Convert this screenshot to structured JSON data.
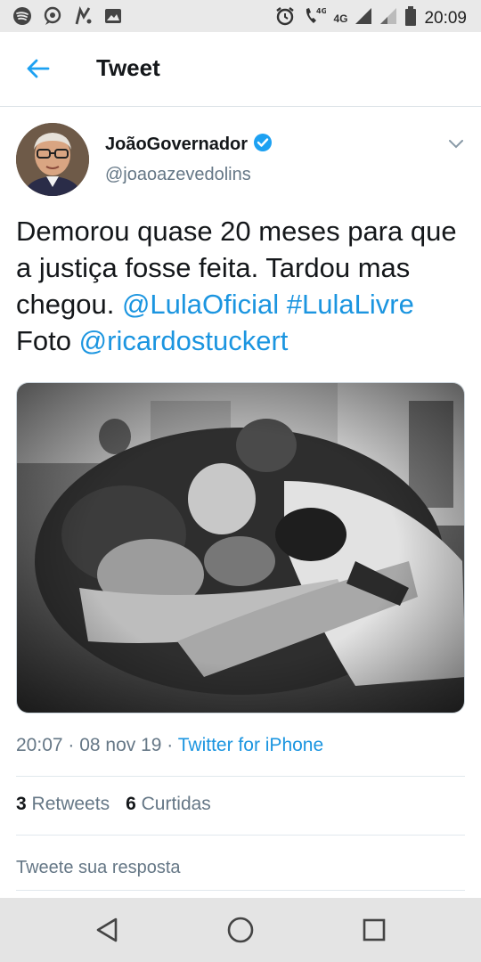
{
  "status_bar": {
    "time": "20:09",
    "network_label_1": "4G",
    "network_label_2": "4G"
  },
  "header": {
    "title": "Tweet"
  },
  "tweet": {
    "display_name": "JoãoGovernador",
    "handle": "@joaoazevedolins",
    "text_part1": "Demorou quase 20 meses para que a justiça fosse feita. Tardou mas chegou. ",
    "mention_1": "@LulaOficial",
    "hashtag": "#LulaLivre",
    "text_part2": " Foto ",
    "mention_2": "@ricardostuckert",
    "timestamp": "20:07 · 08 nov 19 · ",
    "source": "Twitter for iPhone",
    "retweets_count": "3",
    "retweets_label": "Retweets",
    "likes_count": "6",
    "likes_label": "Curtidas",
    "reply_placeholder": "Tweete sua resposta"
  },
  "colors": {
    "accent": "#1b95e0",
    "verified": "#1da1f2",
    "secondary_text": "#657786"
  }
}
